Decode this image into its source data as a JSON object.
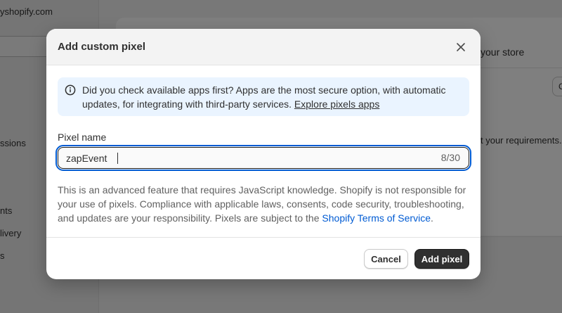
{
  "background": {
    "url_fragment": "yshopify.com",
    "nav_items": [
      "ssions",
      "nts",
      "livery",
      "s"
    ],
    "card_heading_fragment": "your store",
    "card_text_fragment": "t your requirements.",
    "card_button_fragment": "C"
  },
  "modal": {
    "title": "Add custom pixel",
    "banner": {
      "text": "Did you check available apps first? Apps are the most secure option, with automatic updates, for integrating with third-party services. ",
      "link": "Explore pixels apps"
    },
    "field": {
      "label": "Pixel name",
      "value": "zapEvent",
      "counter": "8/30"
    },
    "help": {
      "text": "This is an advanced feature that requires JavaScript knowledge. Shopify is not responsible for your use of pixels. Compliance with applicable laws, consents, code security, troubleshooting, and updates are your responsibility. Pixels are subject to the ",
      "link": "Shopify Terms of Service",
      "suffix": "."
    },
    "buttons": {
      "cancel": "Cancel",
      "primary": "Add pixel"
    }
  },
  "icons": {
    "close": "close-icon",
    "info": "info-icon"
  },
  "colors": {
    "accent": "#005bd3",
    "primary_button": "#303030",
    "banner_bg": "#eaf4ff"
  }
}
